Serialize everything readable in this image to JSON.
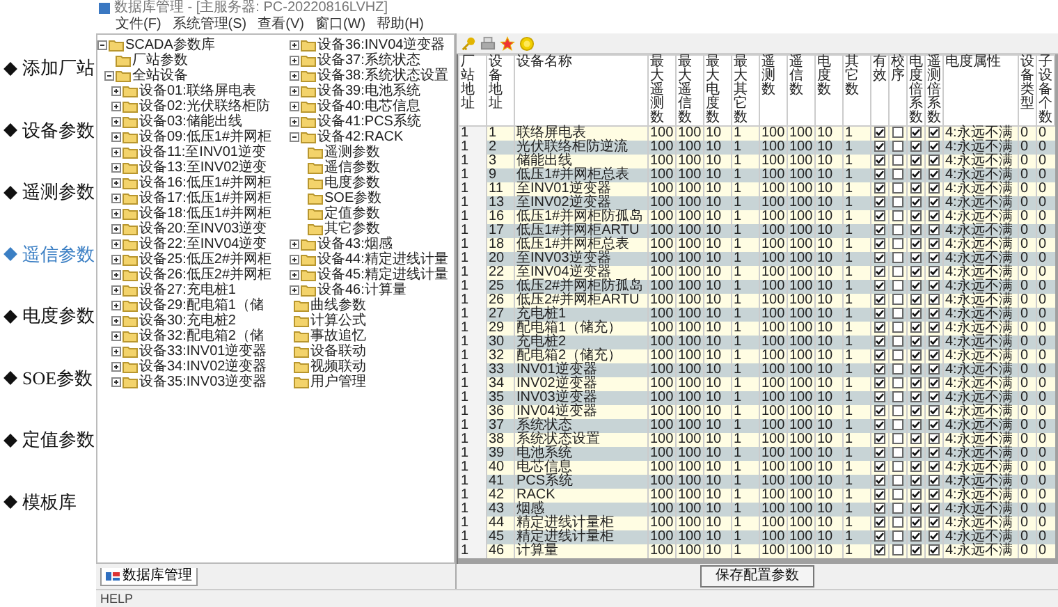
{
  "nav": [
    {
      "label": "添加厂站",
      "selected": false
    },
    {
      "label": "设备参数",
      "selected": false
    },
    {
      "label": "遥测参数",
      "selected": false
    },
    {
      "label": "遥信参数",
      "selected": true
    },
    {
      "label": "电度参数",
      "selected": false
    },
    {
      "label": "SOE参数",
      "selected": false
    },
    {
      "label": "定值参数",
      "selected": false
    },
    {
      "label": "模板库",
      "selected": false
    }
  ],
  "window": {
    "title": "数据库管理 - [主服务器: PC-20220816LVHZ]"
  },
  "menu": [
    "文件(F)",
    "系统管理(S)",
    "查看(V)",
    "窗口(W)",
    "帮助(H)"
  ],
  "tree": [
    {
      "label": "SCADA参数库",
      "expanded": true,
      "children": [
        {
          "label": "厂站参数"
        },
        {
          "label": "全站设备",
          "expanded": true,
          "children": [
            {
              "label": "设备01:联络屏电表",
              "expanded": false
            },
            {
              "label": "设备02:光伏联络柜防",
              "expanded": false
            },
            {
              "label": "设备03:储能出线",
              "expanded": false
            },
            {
              "label": "设备09:低压1#并网柜",
              "expanded": false
            },
            {
              "label": "设备11:至INV01逆变",
              "expanded": false
            },
            {
              "label": "设备13:至INV02逆变",
              "expanded": false
            },
            {
              "label": "设备16:低压1#并网柜",
              "expanded": false
            },
            {
              "label": "设备17:低压1#并网柜",
              "expanded": false
            },
            {
              "label": "设备18:低压1#并网柜",
              "expanded": false
            },
            {
              "label": "设备20:至INV03逆变",
              "expanded": false
            },
            {
              "label": "设备22:至INV04逆变",
              "expanded": false
            },
            {
              "label": "设备25:低压2#并网柜",
              "expanded": false
            },
            {
              "label": "设备26:低压2#并网柜",
              "expanded": false
            },
            {
              "label": "设备27:充电桩1",
              "expanded": false
            },
            {
              "label": "设备29:配电箱1（储",
              "expanded": false
            },
            {
              "label": "设备30:充电桩2",
              "expanded": false
            },
            {
              "label": "设备32:配电箱2（储",
              "expanded": false
            },
            {
              "label": "设备33:INV01逆变器",
              "expanded": false
            },
            {
              "label": "设备34:INV02逆变器",
              "expanded": false
            },
            {
              "label": "设备35:INV03逆变器",
              "expanded": false
            },
            {
              "label": "设备36:INV04逆变器",
              "expanded": false
            },
            {
              "label": "设备37:系统状态",
              "expanded": false
            },
            {
              "label": "设备38:系统状态设置",
              "expanded": false
            },
            {
              "label": "设备39:电池系统",
              "expanded": false
            },
            {
              "label": "设备40:电芯信息",
              "expanded": false
            },
            {
              "label": "设备41:PCS系统",
              "expanded": false
            },
            {
              "label": "设备42:RACK",
              "expanded": true,
              "children": [
                {
                  "label": "遥测参数"
                },
                {
                  "label": "遥信参数"
                },
                {
                  "label": "电度参数"
                },
                {
                  "label": "SOE参数"
                },
                {
                  "label": "定值参数"
                },
                {
                  "label": "其它参数"
                }
              ]
            },
            {
              "label": "设备43:烟感",
              "expanded": false
            },
            {
              "label": "设备44:精定进线计量",
              "expanded": false
            },
            {
              "label": "设备45:精定进线计量",
              "expanded": false
            },
            {
              "label": "设备46:计算量",
              "expanded": false
            }
          ]
        },
        {
          "label": "曲线参数"
        },
        {
          "label": "计算公式"
        },
        {
          "label": "事故追忆"
        },
        {
          "label": "设备联动"
        },
        {
          "label": "视频联动"
        },
        {
          "label": "用户管理"
        }
      ]
    }
  ],
  "tree_tab": "数据库管理",
  "status_bar": "HELP",
  "table": {
    "columns": [
      "厂站地址",
      "设备地址",
      "设备名称",
      "最大遥测数",
      "最大遥信数",
      "最大电度数",
      "最大其它数",
      "遥测数",
      "遥信数",
      "电度数",
      "其它数",
      "有效",
      "校序",
      "电度倍系数",
      "遥测倍系数",
      "电度属性",
      "设备类型",
      "子设备个数"
    ],
    "rows": [
      {
        "cells": [
          "1",
          "1",
          "联络屏电表",
          "100",
          "100",
          "10",
          "1",
          "100",
          "100",
          "10",
          "1"
        ],
        "valid": true,
        "order": false,
        "dd_factor": true,
        "yc_factor": true,
        "attr": "4:永远不满",
        "type": "0",
        "subcount": "0"
      },
      {
        "cells": [
          "1",
          "2",
          "光伏联络柜防逆流",
          "100",
          "100",
          "10",
          "1",
          "100",
          "100",
          "10",
          "1"
        ],
        "valid": true,
        "order": false,
        "dd_factor": true,
        "yc_factor": true,
        "attr": "4:永远不满",
        "type": "0",
        "subcount": "0"
      },
      {
        "cells": [
          "1",
          "3",
          "储能出线",
          "100",
          "100",
          "10",
          "1",
          "100",
          "100",
          "10",
          "1"
        ],
        "valid": true,
        "order": false,
        "dd_factor": true,
        "yc_factor": true,
        "attr": "4:永远不满",
        "type": "0",
        "subcount": "0"
      },
      {
        "cells": [
          "1",
          "9",
          "低压1#并网柜总表",
          "100",
          "100",
          "10",
          "1",
          "100",
          "100",
          "10",
          "1"
        ],
        "valid": true,
        "order": false,
        "dd_factor": true,
        "yc_factor": true,
        "attr": "4:永远不满",
        "type": "0",
        "subcount": "0"
      },
      {
        "cells": [
          "1",
          "11",
          "至INV01逆变器",
          "100",
          "100",
          "10",
          "1",
          "100",
          "100",
          "10",
          "1"
        ],
        "valid": true,
        "order": false,
        "dd_factor": true,
        "yc_factor": true,
        "attr": "4:永远不满",
        "type": "0",
        "subcount": "0"
      },
      {
        "cells": [
          "1",
          "13",
          "至INV02逆变器",
          "100",
          "100",
          "10",
          "1",
          "100",
          "100",
          "10",
          "1"
        ],
        "valid": true,
        "order": false,
        "dd_factor": true,
        "yc_factor": true,
        "attr": "4:永远不满",
        "type": "0",
        "subcount": "0"
      },
      {
        "cells": [
          "1",
          "16",
          "低压1#并网柜防孤岛",
          "100",
          "100",
          "10",
          "1",
          "100",
          "100",
          "10",
          "1"
        ],
        "valid": true,
        "order": false,
        "dd_factor": true,
        "yc_factor": true,
        "attr": "4:永远不满",
        "type": "0",
        "subcount": "0"
      },
      {
        "cells": [
          "1",
          "17",
          "低压1#并网柜ARTU",
          "100",
          "100",
          "10",
          "1",
          "100",
          "100",
          "10",
          "1"
        ],
        "valid": true,
        "order": false,
        "dd_factor": true,
        "yc_factor": true,
        "attr": "4:永远不满",
        "type": "0",
        "subcount": "0"
      },
      {
        "cells": [
          "1",
          "18",
          "低压1#并网柜总表",
          "100",
          "100",
          "10",
          "1",
          "100",
          "100",
          "10",
          "1"
        ],
        "valid": true,
        "order": false,
        "dd_factor": true,
        "yc_factor": true,
        "attr": "4:永远不满",
        "type": "0",
        "subcount": "0"
      },
      {
        "cells": [
          "1",
          "20",
          "至INV03逆变器",
          "100",
          "100",
          "10",
          "1",
          "100",
          "100",
          "10",
          "1"
        ],
        "valid": true,
        "order": false,
        "dd_factor": true,
        "yc_factor": true,
        "attr": "4:永远不满",
        "type": "0",
        "subcount": "0"
      },
      {
        "cells": [
          "1",
          "22",
          "至INV04逆变器",
          "100",
          "100",
          "10",
          "1",
          "100",
          "100",
          "10",
          "1"
        ],
        "valid": true,
        "order": false,
        "dd_factor": true,
        "yc_factor": true,
        "attr": "4:永远不满",
        "type": "0",
        "subcount": "0"
      },
      {
        "cells": [
          "1",
          "25",
          "低压2#并网柜防孤岛",
          "100",
          "100",
          "10",
          "1",
          "100",
          "100",
          "10",
          "1"
        ],
        "valid": true,
        "order": false,
        "dd_factor": true,
        "yc_factor": true,
        "attr": "4:永远不满",
        "type": "0",
        "subcount": "0"
      },
      {
        "cells": [
          "1",
          "26",
          "低压2#并网柜ARTU",
          "100",
          "100",
          "10",
          "1",
          "100",
          "100",
          "10",
          "1"
        ],
        "valid": true,
        "order": false,
        "dd_factor": true,
        "yc_factor": true,
        "attr": "4:永远不满",
        "type": "0",
        "subcount": "0"
      },
      {
        "cells": [
          "1",
          "27",
          "充电桩1",
          "100",
          "100",
          "10",
          "1",
          "100",
          "100",
          "10",
          "1"
        ],
        "valid": true,
        "order": false,
        "dd_factor": true,
        "yc_factor": true,
        "attr": "4:永远不满",
        "type": "0",
        "subcount": "0"
      },
      {
        "cells": [
          "1",
          "29",
          "配电箱1（储充）",
          "100",
          "100",
          "10",
          "1",
          "100",
          "100",
          "10",
          "1"
        ],
        "valid": true,
        "order": false,
        "dd_factor": true,
        "yc_factor": true,
        "attr": "4:永远不满",
        "type": "0",
        "subcount": "0"
      },
      {
        "cells": [
          "1",
          "30",
          "充电桩2",
          "100",
          "100",
          "10",
          "1",
          "100",
          "100",
          "10",
          "1"
        ],
        "valid": true,
        "order": false,
        "dd_factor": true,
        "yc_factor": true,
        "attr": "4:永远不满",
        "type": "0",
        "subcount": "0"
      },
      {
        "cells": [
          "1",
          "32",
          "配电箱2（储充）",
          "100",
          "100",
          "10",
          "1",
          "100",
          "100",
          "10",
          "1"
        ],
        "valid": true,
        "order": false,
        "dd_factor": true,
        "yc_factor": true,
        "attr": "4:永远不满",
        "type": "0",
        "subcount": "0"
      },
      {
        "cells": [
          "1",
          "33",
          "INV01逆变器",
          "100",
          "100",
          "10",
          "1",
          "100",
          "100",
          "10",
          "1"
        ],
        "valid": true,
        "order": false,
        "dd_factor": true,
        "yc_factor": true,
        "attr": "4:永远不满",
        "type": "0",
        "subcount": "0"
      },
      {
        "cells": [
          "1",
          "34",
          "INV02逆变器",
          "100",
          "100",
          "10",
          "1",
          "100",
          "100",
          "10",
          "1"
        ],
        "valid": true,
        "order": false,
        "dd_factor": true,
        "yc_factor": true,
        "attr": "4:永远不满",
        "type": "0",
        "subcount": "0"
      },
      {
        "cells": [
          "1",
          "35",
          "INV03逆变器",
          "100",
          "100",
          "10",
          "1",
          "100",
          "100",
          "10",
          "1"
        ],
        "valid": true,
        "order": false,
        "dd_factor": true,
        "yc_factor": true,
        "attr": "4:永远不满",
        "type": "0",
        "subcount": "0"
      },
      {
        "cells": [
          "1",
          "36",
          "INV04逆变器",
          "100",
          "100",
          "10",
          "1",
          "100",
          "100",
          "10",
          "1"
        ],
        "valid": true,
        "order": false,
        "dd_factor": true,
        "yc_factor": true,
        "attr": "4:永远不满",
        "type": "0",
        "subcount": "0"
      },
      {
        "cells": [
          "1",
          "37",
          "系统状态",
          "100",
          "100",
          "10",
          "1",
          "100",
          "100",
          "10",
          "1"
        ],
        "valid": true,
        "order": false,
        "dd_factor": true,
        "yc_factor": true,
        "attr": "4:永远不满",
        "type": "0",
        "subcount": "0"
      },
      {
        "cells": [
          "1",
          "38",
          "系统状态设置",
          "100",
          "100",
          "10",
          "1",
          "100",
          "100",
          "10",
          "1"
        ],
        "valid": true,
        "order": false,
        "dd_factor": true,
        "yc_factor": true,
        "attr": "4:永远不满",
        "type": "0",
        "subcount": "0"
      },
      {
        "cells": [
          "1",
          "39",
          "电池系统",
          "100",
          "100",
          "10",
          "1",
          "100",
          "100",
          "10",
          "1"
        ],
        "valid": true,
        "order": false,
        "dd_factor": true,
        "yc_factor": true,
        "attr": "4:永远不满",
        "type": "0",
        "subcount": "0"
      },
      {
        "cells": [
          "1",
          "40",
          "电芯信息",
          "100",
          "100",
          "10",
          "1",
          "100",
          "100",
          "10",
          "1"
        ],
        "valid": true,
        "order": false,
        "dd_factor": true,
        "yc_factor": true,
        "attr": "4:永远不满",
        "type": "0",
        "subcount": "0"
      },
      {
        "cells": [
          "1",
          "41",
          "PCS系统",
          "100",
          "100",
          "10",
          "1",
          "100",
          "100",
          "10",
          "1"
        ],
        "valid": true,
        "order": false,
        "dd_factor": true,
        "yc_factor": true,
        "attr": "4:永远不满",
        "type": "0",
        "subcount": "0"
      },
      {
        "cells": [
          "1",
          "42",
          "RACK",
          "100",
          "100",
          "10",
          "1",
          "100",
          "100",
          "10",
          "1"
        ],
        "valid": true,
        "order": false,
        "dd_factor": true,
        "yc_factor": true,
        "attr": "4:永远不满",
        "type": "0",
        "subcount": "0"
      },
      {
        "cells": [
          "1",
          "43",
          "烟感",
          "100",
          "100",
          "10",
          "1",
          "100",
          "100",
          "10",
          "1"
        ],
        "valid": true,
        "order": false,
        "dd_factor": true,
        "yc_factor": true,
        "attr": "4:永远不满",
        "type": "0",
        "subcount": "0"
      },
      {
        "cells": [
          "1",
          "44",
          "精定进线计量柜",
          "100",
          "100",
          "10",
          "1",
          "100",
          "100",
          "10",
          "1"
        ],
        "valid": true,
        "order": false,
        "dd_factor": true,
        "yc_factor": true,
        "attr": "4:永远不满",
        "type": "0",
        "subcount": "0"
      },
      {
        "cells": [
          "1",
          "45",
          "精定进线计量柜",
          "100",
          "100",
          "10",
          "1",
          "100",
          "100",
          "10",
          "1"
        ],
        "valid": true,
        "order": false,
        "dd_factor": true,
        "yc_factor": true,
        "attr": "4:永远不满",
        "type": "0",
        "subcount": "0"
      },
      {
        "cells": [
          "1",
          "46",
          "计算量",
          "100",
          "100",
          "10",
          "1",
          "100",
          "100",
          "10",
          "1"
        ],
        "valid": true,
        "order": false,
        "dd_factor": true,
        "yc_factor": true,
        "attr": "4:永远不满",
        "type": "0",
        "subcount": "0"
      }
    ]
  },
  "save_button": "保存配置参数"
}
